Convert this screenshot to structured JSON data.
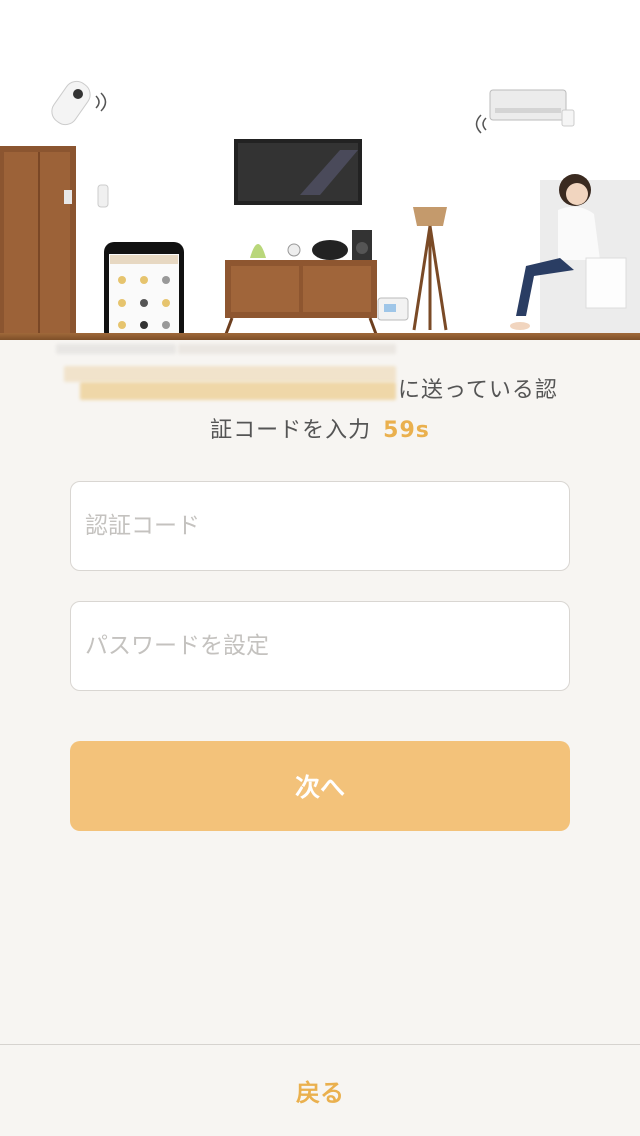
{
  "message": {
    "line1_tail": "に送っている認",
    "line2": "証コードを入力",
    "countdown": "59s"
  },
  "form": {
    "code_placeholder": "認証コード",
    "password_placeholder": "パスワードを設定",
    "next_label": "次へ"
  },
  "footer": {
    "back_label": "戻る"
  },
  "colors": {
    "accent": "#eab04e",
    "button": "#f3c27a",
    "background": "#f7f5f2"
  }
}
